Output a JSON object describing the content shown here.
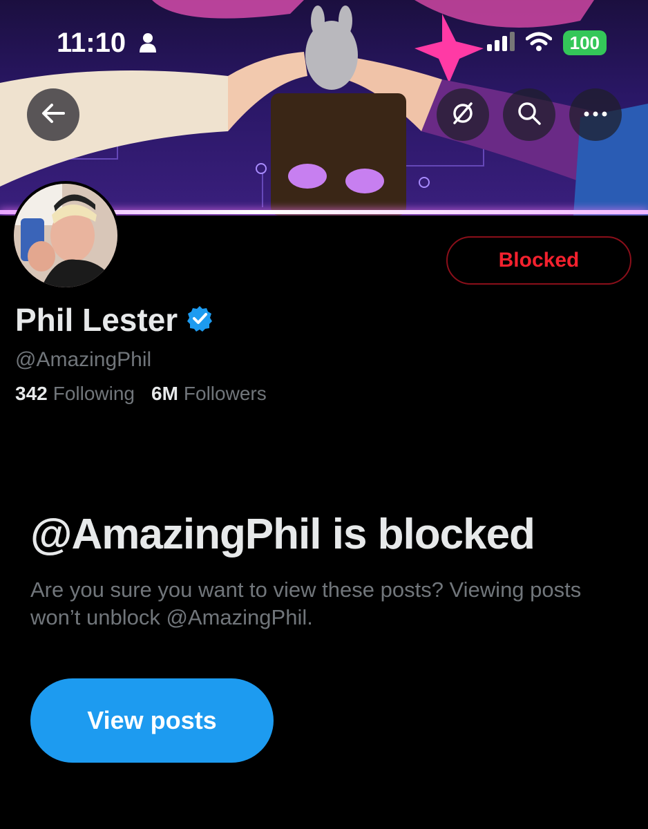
{
  "status_bar": {
    "time": "11:10",
    "battery": "100"
  },
  "profile": {
    "display_name": "Phil Lester",
    "handle": "@AmazingPhil",
    "following_count": "342",
    "following_label": "Following",
    "followers_count": "6M",
    "followers_label": "Followers",
    "verified": true
  },
  "actions": {
    "blocked_label": "Blocked"
  },
  "blocked_notice": {
    "title": "@AmazingPhil is blocked",
    "message": "Are you sure you want to view these posts? Viewing posts won’t unblock @AmazingPhil.",
    "button_label": "View posts"
  },
  "colors": {
    "accent": "#1d9bf0",
    "blocked_red": "#f4212e",
    "battery_green": "#34c759"
  },
  "icons": [
    "back-arrow-icon",
    "grok-icon",
    "search-icon",
    "more-icon",
    "verified-badge-icon",
    "person-icon",
    "signal-icon",
    "wifi-icon"
  ]
}
